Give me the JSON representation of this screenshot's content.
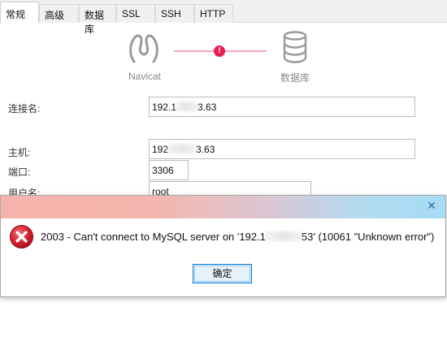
{
  "tabs": [
    {
      "label": "常规",
      "active": true
    },
    {
      "label": "高级"
    },
    {
      "label": "数据库"
    },
    {
      "label": "SSL"
    },
    {
      "label": "SSH"
    },
    {
      "label": "HTTP"
    }
  ],
  "diagram": {
    "source_label": "Navicat",
    "target_label": "数据库",
    "status_icon": "error-exclamation-icon",
    "error_color": "#e91e50",
    "line_color": "#f4a9bb"
  },
  "form": {
    "connection_name_label": "连接名:",
    "connection_name_prefix": "192.1",
    "connection_name_suffix": "3.63",
    "host_label": "主机:",
    "host_prefix": "192",
    "host_suffix": "3.63",
    "port_label": "端口:",
    "port_value": "3306",
    "username_label": "用户名:",
    "username_value": "root"
  },
  "dialog": {
    "close_symbol": "✕",
    "icon": "error-x-icon",
    "message_prefix": "2003 - Can't connect to MySQL server on '192.1",
    "message_suffix": "53' (10061 \"Unknown error\")",
    "ok_label": "确定",
    "accent_color": "#0078d7"
  }
}
